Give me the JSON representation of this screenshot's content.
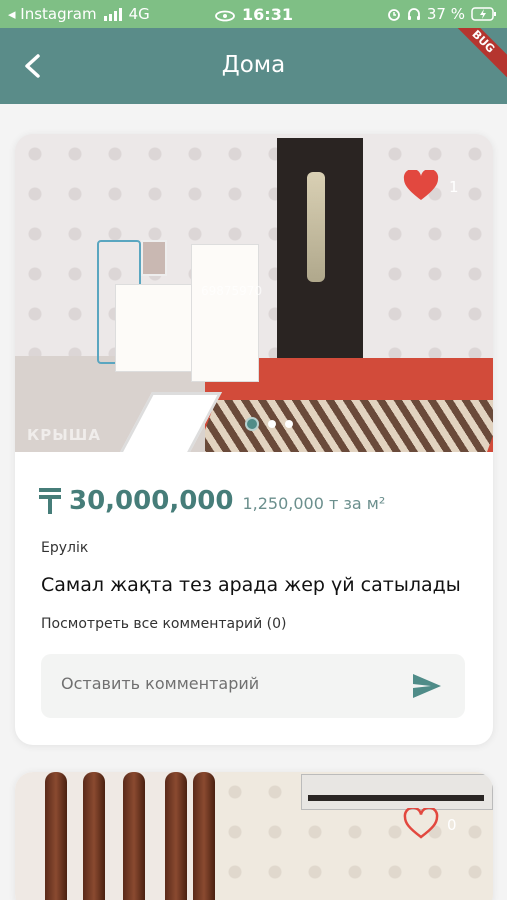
{
  "status_bar": {
    "back_app": "◂ Instagram",
    "network": "4G",
    "time": "16:31",
    "battery": "37 %"
  },
  "nav": {
    "title": "Дома",
    "debug_banner": "BUG"
  },
  "listings": [
    {
      "photo_watermark": "69875970",
      "photo_logo": "КРЫША",
      "favorites_count": "1",
      "favorited": true,
      "price": "30,000,000",
      "price_per_m2": "1,250,000 т за м²",
      "district": "Ерулік",
      "title": "Самал жақта тез арада жер үй сатылады",
      "comments_link": "Посмотреть все комментарий (0)",
      "comment_placeholder": "Оставить комментарий",
      "carousel": {
        "total": 3,
        "active": 0
      }
    },
    {
      "favorites_count": "0",
      "favorited": false
    }
  ],
  "colors": {
    "status_bar": "#7fbf85",
    "nav_bar": "#5a8c89",
    "accent": "#467d79",
    "heart_filled": "#e2483f",
    "debug_banner": "#b5352f"
  }
}
